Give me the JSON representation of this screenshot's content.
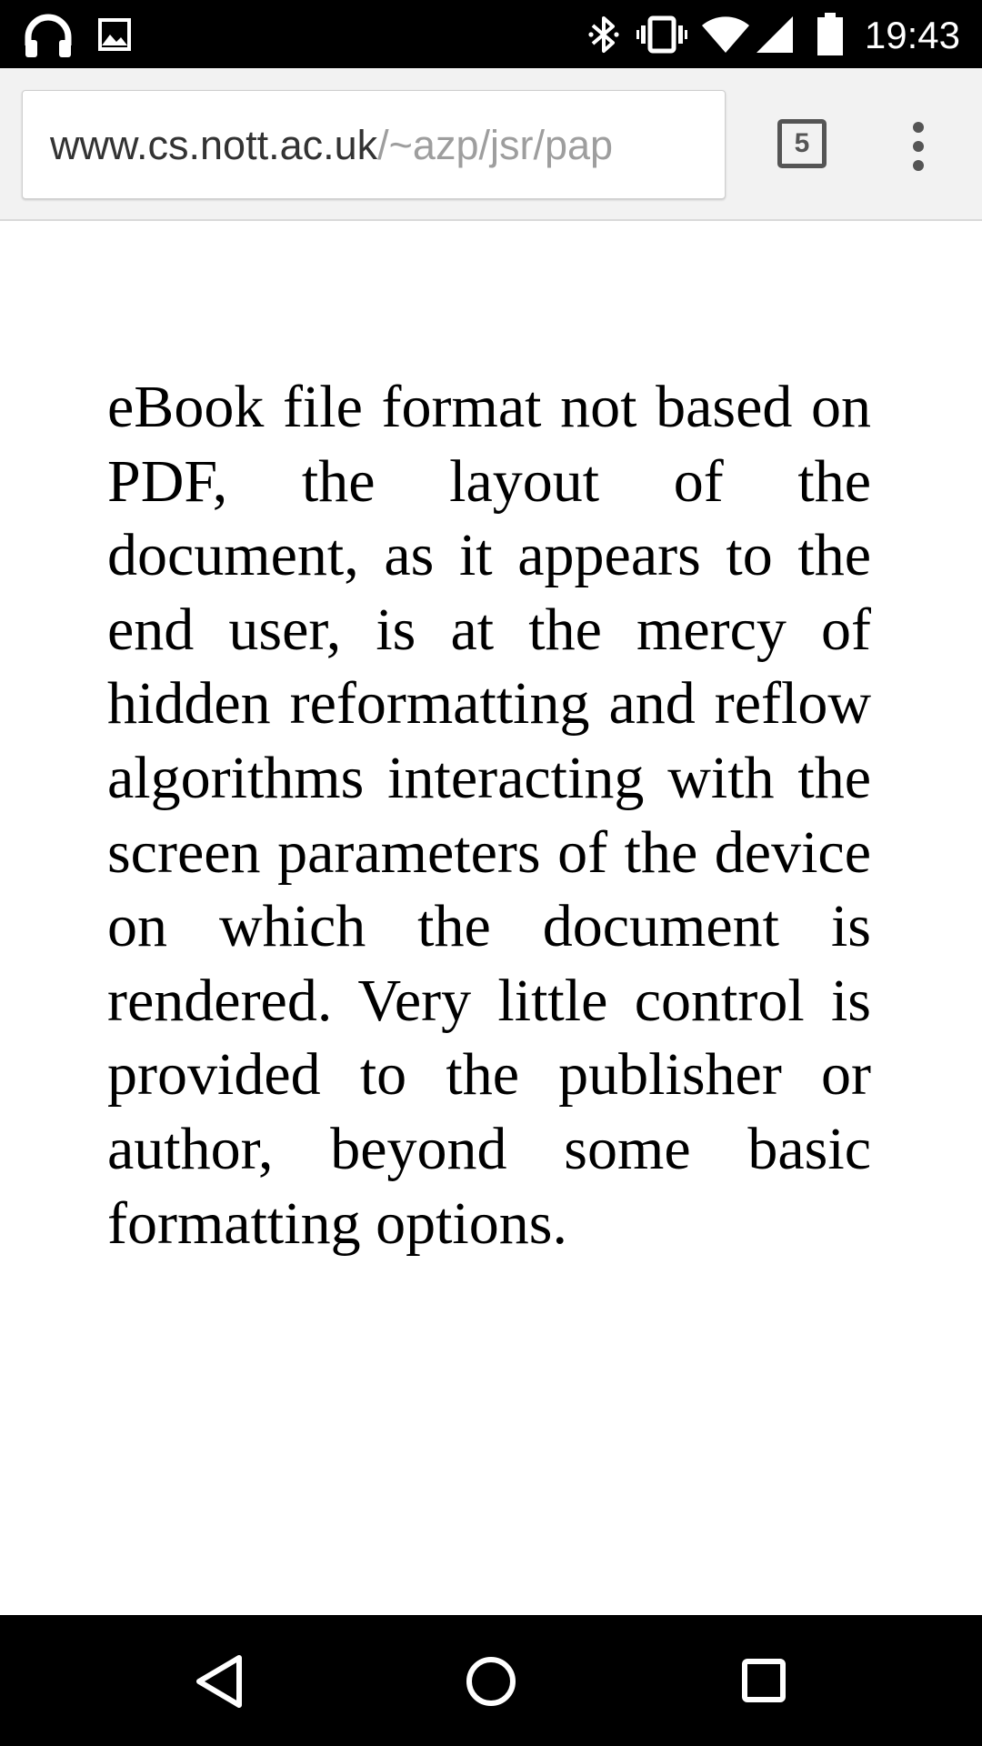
{
  "status_bar": {
    "time": "19:43",
    "left_icons": [
      "headphones-icon",
      "image-icon"
    ],
    "right_icons": [
      "bluetooth-icon",
      "vibrate-icon",
      "wifi-icon",
      "cell-signal-icon",
      "battery-icon"
    ]
  },
  "browser": {
    "url_domain": "www.cs.nott.ac.uk",
    "url_path": "/~azp/jsr/pap",
    "tab_count": "5",
    "menu_icon": "overflow-menu-icon"
  },
  "content": {
    "paragraph": "eBook file format not based on PDF, the layout of the document, as it appears to the end user, is at the mercy of hidden reformatting and reflow algorithms interacting with the screen parameters of the device on which the document is rendered. Very little control is provided to the publisher or author, beyond some basic formatting options."
  },
  "nav_bar": {
    "icons": [
      "back-icon",
      "home-icon",
      "recents-icon"
    ]
  },
  "colors": {
    "status_bar_bg": "#000000",
    "toolbar_bg": "#f2f2f2",
    "url_domain": "#333333",
    "url_path": "#9e9e9e",
    "text": "#000000"
  }
}
